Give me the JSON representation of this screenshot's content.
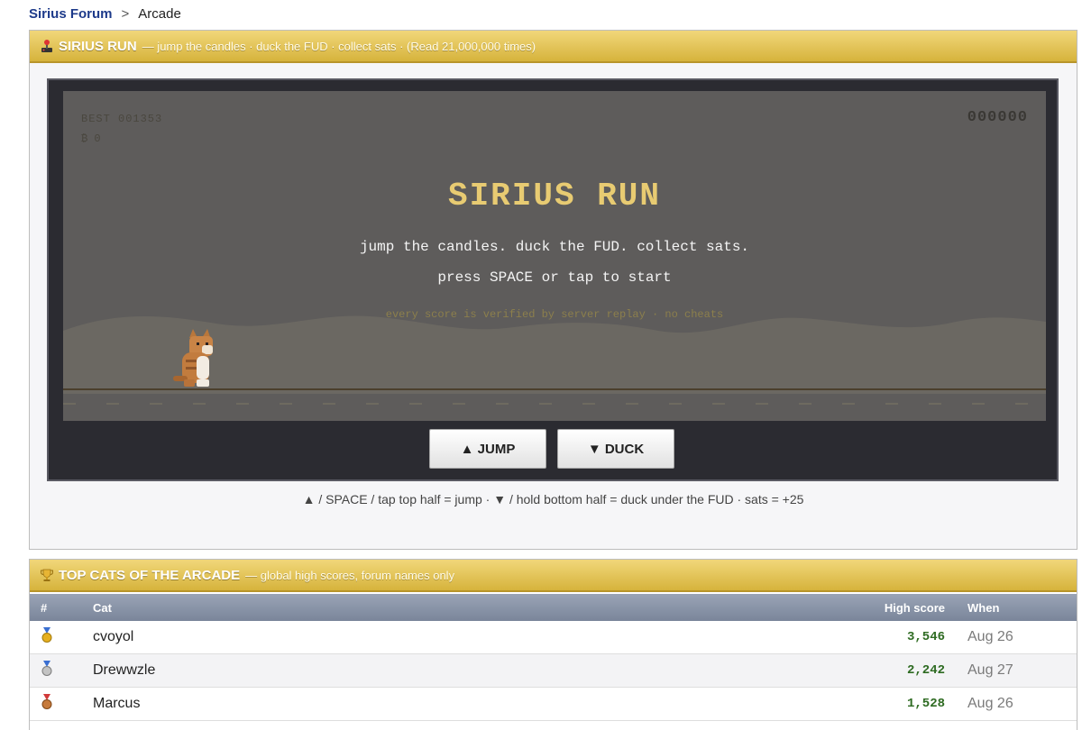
{
  "breadcrumb": {
    "forum": "Sirius Forum",
    "separator": ">",
    "current": "Arcade"
  },
  "game_panel": {
    "title": "SIRIUS RUN",
    "subtitle": "— jump the candles · duck the FUD · collect sats · (Read 21,000,000 times)",
    "icon": "joystick-icon"
  },
  "game": {
    "best": "BEST 001353",
    "sats": "₿ 0",
    "score": "000000",
    "title": "SIRIUS RUN",
    "tagline": "jump the candles. duck the FUD. collect sats.",
    "prompt": "press SPACE or tap to start",
    "note": "every score is verified by server replay · no cheats",
    "colors": {
      "title": "#e8cb72",
      "canvas": "#5e5c5b",
      "frame": "#2b2b31"
    }
  },
  "controls": {
    "jump": "▲ JUMP",
    "duck": "▼ DUCK"
  },
  "help": "▲ / SPACE / tap top half = jump · ▼ / hold bottom half = duck under the FUD · sats = +25",
  "scores_panel": {
    "title": "TOP CATS OF THE ARCADE",
    "subtitle": "— global high scores, forum names only",
    "icon": "trophy-icon",
    "columns": {
      "rank": "#",
      "cat": "Cat",
      "score": "High score",
      "when": "When"
    },
    "rows": [
      {
        "medal": "gold-medal-icon",
        "cat": "cvoyol",
        "score": "3,546",
        "when": "Aug 26"
      },
      {
        "medal": "silver-medal-icon",
        "cat": "Drewwzle",
        "score": "2,242",
        "when": "Aug 27"
      },
      {
        "medal": "bronze-medal-icon",
        "cat": "Marcus",
        "score": "1,528",
        "when": "Aug 26"
      }
    ]
  }
}
